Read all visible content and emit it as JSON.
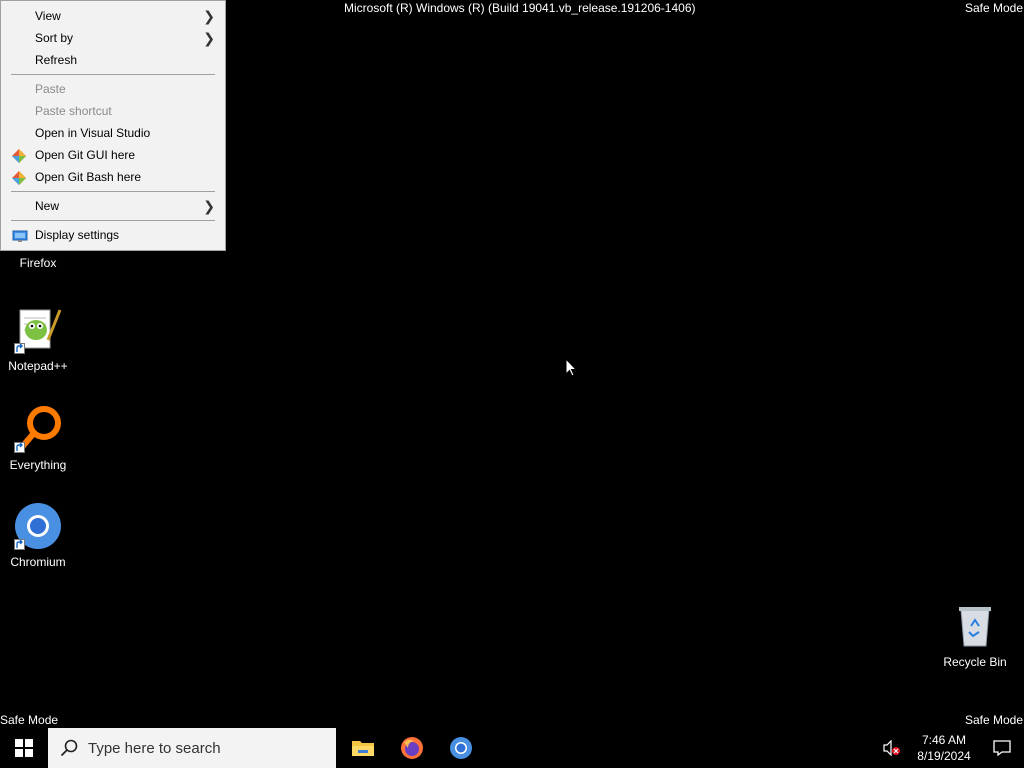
{
  "header": {
    "build_text": "Microsoft (R) Windows (R) (Build 19041.vb_release.191206-1406)",
    "safe_mode_top_right": "Safe Mode",
    "safe_mode_bottom_left": "Safe Mode",
    "safe_mode_bottom_right": "Safe Mode"
  },
  "context_menu": {
    "items": [
      {
        "label": "View",
        "submenu": true,
        "enabled": true
      },
      {
        "label": "Sort by",
        "submenu": true,
        "enabled": true
      },
      {
        "label": "Refresh",
        "enabled": true
      },
      {
        "label": "Paste",
        "enabled": false
      },
      {
        "label": "Paste shortcut",
        "enabled": false
      },
      {
        "label": "Open in Visual Studio",
        "enabled": true
      },
      {
        "label": "Open Git GUI here",
        "icon": "git-icon",
        "enabled": true
      },
      {
        "label": "Open Git Bash here",
        "icon": "git-icon",
        "enabled": true
      },
      {
        "label": "New",
        "submenu": true,
        "enabled": true
      },
      {
        "label": "Display settings",
        "icon": "display-icon",
        "enabled": true
      }
    ]
  },
  "desktop": {
    "icons": [
      {
        "label": "Firefox",
        "icon": "firefox-icon"
      },
      {
        "label": "Notepad++",
        "icon": "notepadpp-icon"
      },
      {
        "label": "Everything",
        "icon": "everything-icon"
      },
      {
        "label": "Chromium",
        "icon": "chromium-icon"
      },
      {
        "label": "Recycle Bin",
        "icon": "recycle-bin-icon"
      }
    ]
  },
  "taskbar": {
    "search_placeholder": "Type here to search",
    "pinned": [
      {
        "name": "File Explorer",
        "icon": "folder-icon"
      },
      {
        "name": "Firefox",
        "icon": "firefox-icon"
      },
      {
        "name": "Chromium",
        "icon": "chromium-icon"
      }
    ],
    "clock_time": "7:46 AM",
    "clock_date": "8/19/2024"
  },
  "colors": {
    "desktop_bg": "#000000",
    "menu_bg": "#f2f2f2",
    "menu_disabled": "#8a8a8a",
    "search_bg": "#f3f3f3"
  }
}
